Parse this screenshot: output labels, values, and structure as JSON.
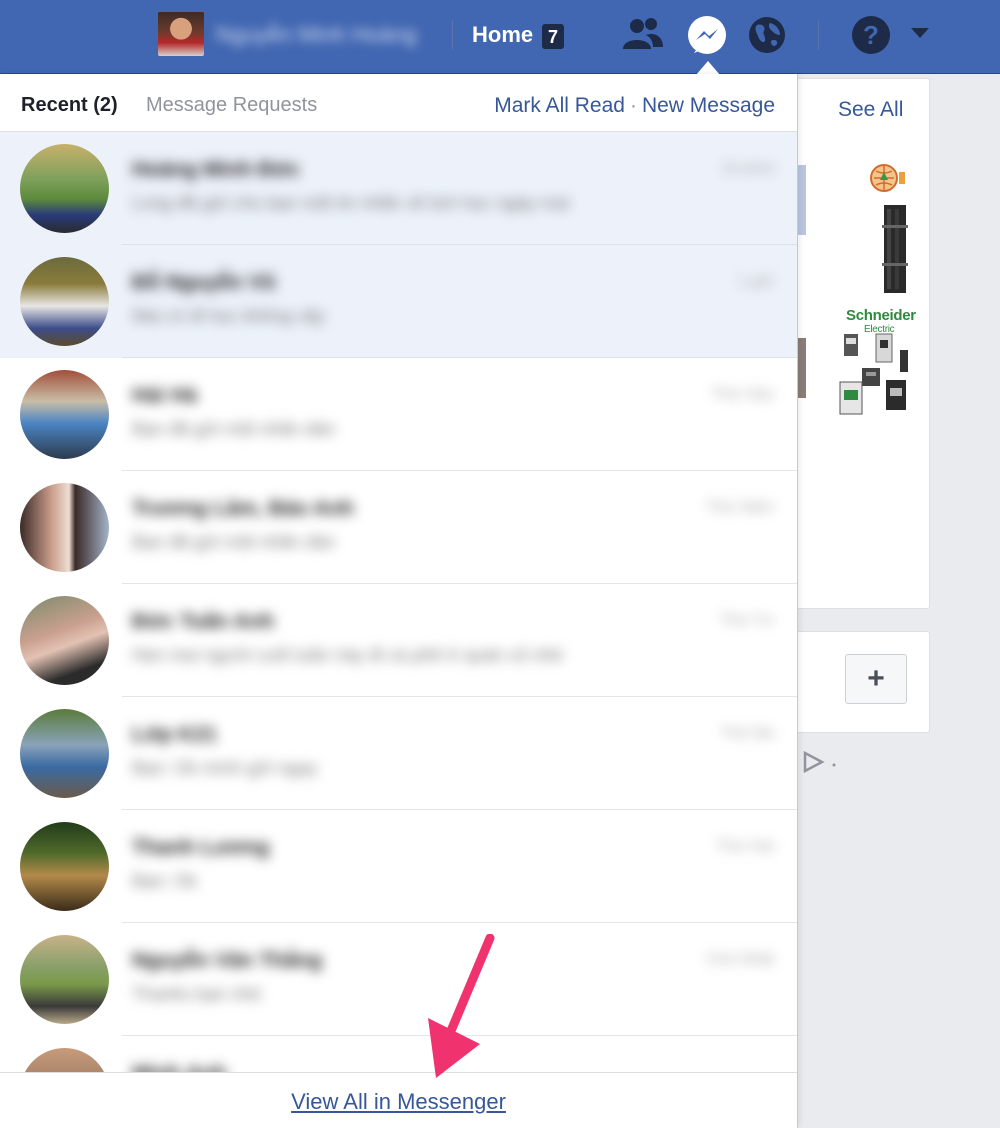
{
  "topbar": {
    "user_name": "Nguyễn Minh Hoàng",
    "home_label": "Home",
    "home_badge": "7",
    "icons": [
      "friends-icon",
      "messenger-icon",
      "globe-icon",
      "help-icon",
      "caret-down-icon"
    ]
  },
  "messages": {
    "tab_recent": "Recent (2)",
    "tab_requests": "Message Requests",
    "mark_all_read": "Mark All Read",
    "separator": "·",
    "new_message": "New Message",
    "conversations": [
      {
        "name": "Hoàng Minh Đức",
        "snippet": "Long đã gửi cho bạn một tin nhắn về lịch học ngày mai",
        "time": "10 phút",
        "unread": true
      },
      {
        "name": "Đỗ Nguyễn Vũ",
        "snippet": "Mai có đi học không vậy",
        "time": "1 giờ",
        "unread": true
      },
      {
        "name": "Hải Hà",
        "snippet": "Bạn đã gửi một nhãn dán",
        "time": "Thứ Sáu",
        "unread": false
      },
      {
        "name": "Trương Lâm, Bảo Anh",
        "snippet": "Bạn đã gửi một nhãn dán",
        "time": "Thứ Năm",
        "unread": false
      },
      {
        "name": "Đức Tuấn Anh",
        "snippet": "Hẹn mọi người cuối tuần này đi cà phê ở quán cũ nhé",
        "time": "Thứ Tư",
        "unread": false
      },
      {
        "name": "Lớp K21",
        "snippet": "Bạn: Ok mình gửi ngay",
        "time": "Thứ Ba",
        "unread": false
      },
      {
        "name": "Thanh Lương",
        "snippet": "Bạn: Ok",
        "time": "Thứ Hai",
        "unread": false
      },
      {
        "name": "Nguyễn Văn Thắng",
        "snippet": "Thanks bạn nhé",
        "time": "Chủ Nhật",
        "unread": false
      },
      {
        "name": "Minh Anh",
        "snippet": "",
        "time": "",
        "unread": false
      }
    ],
    "view_all": "View All in Messenger"
  },
  "sidebar": {
    "see_all": "See All",
    "ad_brand": "Schneider",
    "ad_brand_sub": "Electric",
    "add_label": "+"
  },
  "colors": {
    "topbar": "#4267b2",
    "link": "#365899",
    "unread_row": "#edf2fa",
    "annotation_arrow": "#f0326e"
  }
}
